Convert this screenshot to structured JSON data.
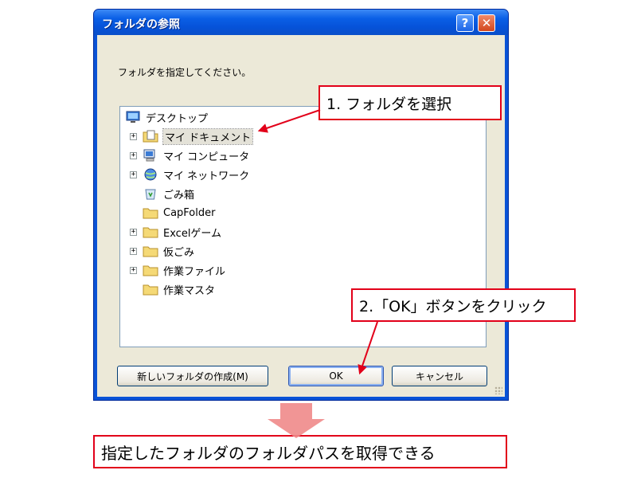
{
  "dialog": {
    "title": "フォルダの参照",
    "instruction": "フォルダを指定してください。",
    "tree": [
      {
        "label": "デスクトップ",
        "icon": "desktop-icon",
        "expander": ""
      },
      {
        "label": "マイ ドキュメント",
        "icon": "my-documents-icon",
        "expander": "+"
      },
      {
        "label": "マイ コンピュータ",
        "icon": "my-computer-icon",
        "expander": "+"
      },
      {
        "label": "マイ ネットワーク",
        "icon": "my-network-icon",
        "expander": "+"
      },
      {
        "label": "ごみ箱",
        "icon": "recycle-bin-icon",
        "expander": ""
      },
      {
        "label": "CapFolder",
        "icon": "folder-icon",
        "expander": ""
      },
      {
        "label": "Excelゲーム",
        "icon": "folder-icon",
        "expander": "+"
      },
      {
        "label": "仮ごみ",
        "icon": "folder-icon",
        "expander": "+"
      },
      {
        "label": "作業ファイル",
        "icon": "folder-icon",
        "expander": "+"
      },
      {
        "label": "作業マスタ",
        "icon": "folder-icon",
        "expander": ""
      }
    ],
    "buttons": {
      "new_folder": "新しいフォルダの作成(M)",
      "ok": "OK",
      "cancel": "キャンセル"
    },
    "title_buttons": {
      "help": "?",
      "close": "✕"
    }
  },
  "annotations": {
    "step1": "1. フォルダを選択",
    "step2": "2.「OK」ボタンをクリック",
    "result": "指定したフォルダのフォルダパスを取得できる"
  },
  "colors": {
    "callout_border": "#e2001a",
    "arrow": "#e2001a",
    "down_arrow": "#f08a8a",
    "titlebar": "#0a5fe6"
  }
}
